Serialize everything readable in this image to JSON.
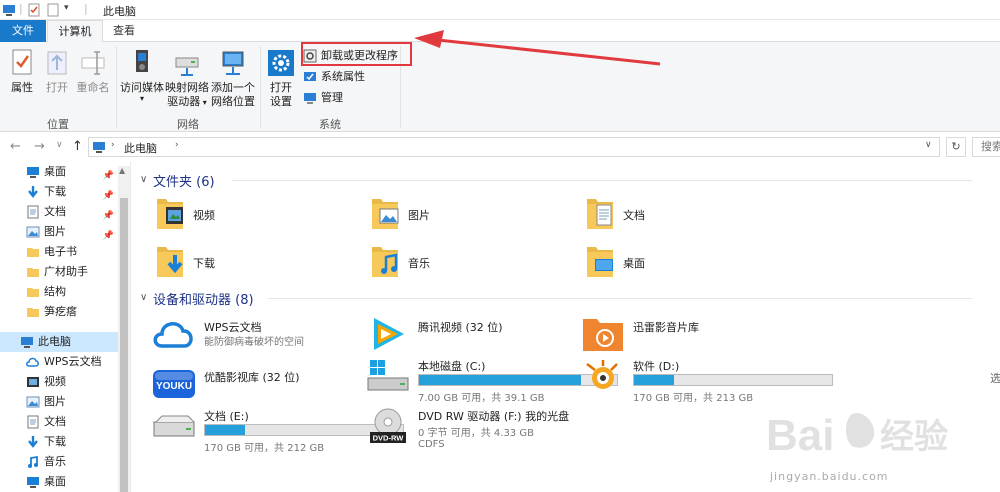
{
  "window": {
    "title": "此电脑"
  },
  "ribbon": {
    "tabs": [
      {
        "label": "文件"
      },
      {
        "label": "计算机"
      },
      {
        "label": "查看"
      }
    ],
    "location_group": {
      "label": "位置",
      "properties": "属性",
      "open": "打开",
      "rename": "重命名"
    },
    "network_group": {
      "label": "网络",
      "access_media": "访问媒体",
      "map_drive_1": "映射网络",
      "map_drive_2": "驱动器",
      "add_location_1": "添加一个",
      "add_location_2": "网络位置"
    },
    "system_group": {
      "label": "系统",
      "open_settings_1": "打开",
      "open_settings_2": "设置",
      "uninstall": "卸载或更改程序",
      "system_properties": "系统属性",
      "manage": "管理"
    }
  },
  "address": {
    "path": "此电脑",
    "search_placeholder": "搜索"
  },
  "nav": {
    "quick_access": [
      {
        "label": "桌面",
        "icon": "desktop-icon",
        "pinned": true
      },
      {
        "label": "下载",
        "icon": "download-icon",
        "pinned": true
      },
      {
        "label": "文档",
        "icon": "document-icon",
        "pinned": true
      },
      {
        "label": "图片",
        "icon": "pictures-icon",
        "pinned": true
      },
      {
        "label": "电子书",
        "icon": "folder-icon",
        "pinned": false
      },
      {
        "label": "广材助手",
        "icon": "folder-icon",
        "pinned": false
      },
      {
        "label": "结构",
        "icon": "folder-icon",
        "pinned": false
      },
      {
        "label": "笋疙瘩",
        "icon": "folder-icon",
        "pinned": false
      }
    ],
    "this_pc": "此电脑",
    "pc_children": [
      {
        "label": "WPS云文档",
        "icon": "cloud-icon"
      },
      {
        "label": "视频",
        "icon": "video-icon"
      },
      {
        "label": "图片",
        "icon": "pictures-icon"
      },
      {
        "label": "文档",
        "icon": "document-icon"
      },
      {
        "label": "下载",
        "icon": "download-icon"
      },
      {
        "label": "音乐",
        "icon": "music-icon"
      },
      {
        "label": "桌面",
        "icon": "desktop-icon"
      }
    ]
  },
  "content": {
    "folders_title": "文件夹 (6)",
    "folders": [
      {
        "label": "视频"
      },
      {
        "label": "图片"
      },
      {
        "label": "文档"
      },
      {
        "label": "下载"
      },
      {
        "label": "音乐"
      },
      {
        "label": "桌面"
      }
    ],
    "devices_title": "设备和驱动器 (8)",
    "devices": [
      {
        "name": "WPS云文档",
        "sub": "能防御病毒破坏的空间"
      },
      {
        "name": "腾讯视频 (32 位)",
        "sub": ""
      },
      {
        "name": "迅雷影音片库",
        "sub": ""
      },
      {
        "name": "优酷影视库 (32 位)",
        "sub": ""
      },
      {
        "name": "本地磁盘 (C:)",
        "sub": "7.00 GB 可用，共 39.1 GB",
        "used": 0.82
      },
      {
        "name": "软件 (D:)",
        "sub": "170 GB 可用，共 213 GB",
        "used": 0.2
      },
      {
        "name": "文档 (E:)",
        "sub": "170 GB 可用，共 212 GB",
        "used": 0.2
      },
      {
        "name": "DVD RW 驱动器 (F:) 我的光盘",
        "sub": "0 字节 可用，共 4.33 GB",
        "sub2": "CDFS",
        "badge": "DVD-RW"
      }
    ],
    "right_hint": "选"
  },
  "watermark": {
    "text": "jingyan.baidu.com",
    "brand": "Bai",
    "brand2": "经验"
  },
  "colors": {
    "accent": "#1979ca",
    "bar": "#26a0da",
    "folder": "#f7c85a",
    "highlight": "#e03a3e"
  }
}
